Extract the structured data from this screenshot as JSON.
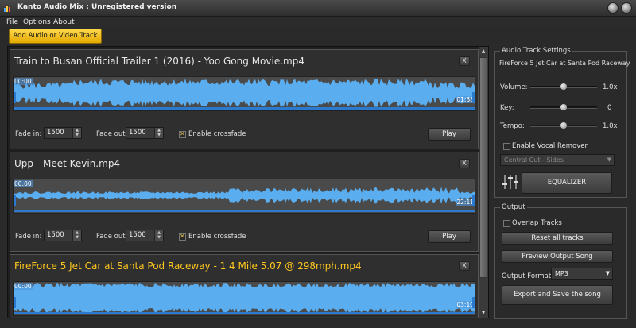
{
  "window": {
    "title": "Kanto Audio Mix : Unregistered version"
  },
  "menu": [
    "File",
    "Options",
    "About"
  ],
  "toolbar": {
    "add_label": "Add Audio or Video Track"
  },
  "tracks": [
    {
      "name": "Train to Busan Official Trailer 1 (2016) - Yoo Gong Movie.mp4",
      "start_time": "00:00",
      "end_time": "01:38",
      "fade_in_label": "Fade in:",
      "fade_in": "1500",
      "fade_out_label": "Fade out:",
      "fade_out": "1500",
      "crossfade_label": "Enable crossfade",
      "crossfade": true,
      "play_label": "Play",
      "close_label": "X",
      "active": false
    },
    {
      "name": "Upp - Meet Kevin.mp4",
      "start_time": "00:00",
      "end_time": "22:11",
      "fade_in_label": "Fade in:",
      "fade_in": "1500",
      "fade_out_label": "Fade out:",
      "fade_out": "1500",
      "crossfade_label": "Enable crossfade",
      "crossfade": true,
      "play_label": "Play",
      "close_label": "X",
      "active": false
    },
    {
      "name": "FireForce 5 Jet Car at Santa Pod Raceway - 1 4 Mile 5.07 @ 298mph.mp4",
      "start_time": "00:00",
      "end_time": "03:10",
      "close_label": "X",
      "active": true
    }
  ],
  "settings": {
    "group_title": "Audio Track Settings",
    "track_name": "FireForce 5 Jet Car at Santa Pod Raceway",
    "volume": {
      "label": "Volume:",
      "value": "1.0x",
      "level": 0.5
    },
    "key": {
      "label": "Key:",
      "value": "0",
      "level": 0.5
    },
    "tempo": {
      "label": "Tempo:",
      "value": "1.0x",
      "level": 0.5
    },
    "vocal_remover_label": "Enable Vocal Remover",
    "vocal_mode": "Central Cut - Sides",
    "equalizer_label": "EQUALIZER"
  },
  "output": {
    "group_title": "Output",
    "overlap_label": "Overlap Tracks",
    "reset_label": "Reset all tracks",
    "preview_label": "Preview Output Song",
    "format_label": "Output Format:",
    "format_value": "MP3",
    "export_label": "Export and Save the song"
  },
  "colors": {
    "accent": "#ffc81e",
    "wave": "#5aaef0",
    "marker": "#2a7bd0"
  }
}
